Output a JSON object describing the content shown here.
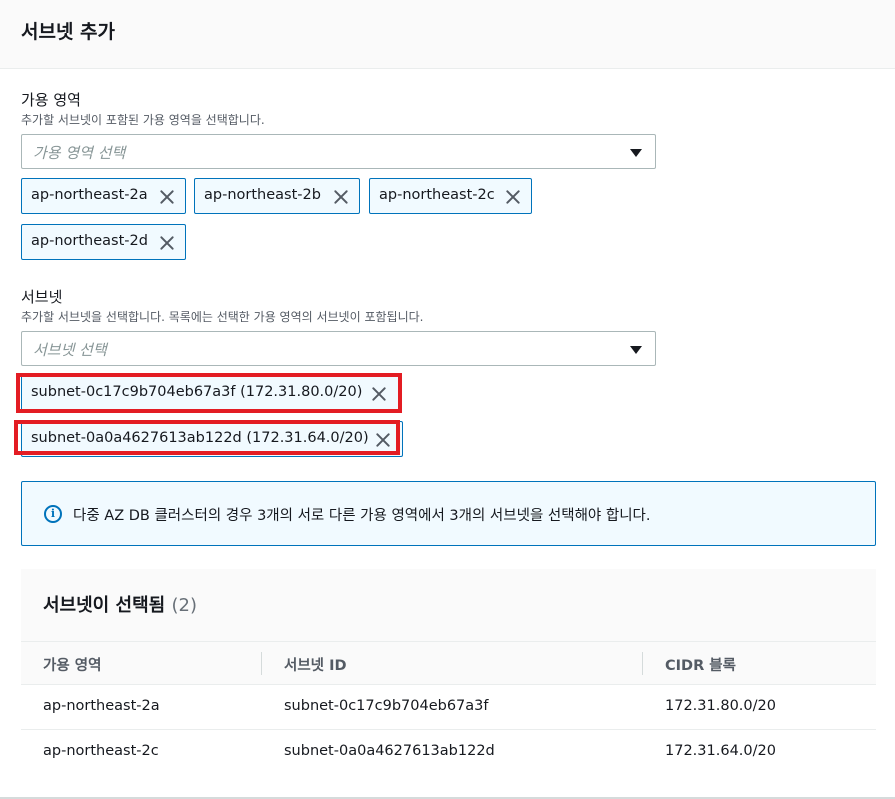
{
  "header": {
    "title": "서브넷 추가"
  },
  "az_field": {
    "label": "가용 영역",
    "description": "추가할 서브넷이 포함된 가용 영역을 선택합니다.",
    "placeholder": "가용 영역 선택",
    "tokens": [
      "ap-northeast-2a",
      "ap-northeast-2b",
      "ap-northeast-2c",
      "ap-northeast-2d"
    ]
  },
  "subnet_field": {
    "label": "서브넷",
    "description": "추가할 서브넷을 선택합니다. 목록에는 선택한 가용 영역의 서브넷이 포함됩니다.",
    "placeholder": "서브넷 선택",
    "tokens": [
      "subnet-0c17c9b704eb67a3f (172.31.80.0/20)",
      "subnet-0a0a4627613ab122d (172.31.64.0/20)"
    ]
  },
  "alert": {
    "icon": "info-icon",
    "text": "다중 AZ DB 클러스터의 경우 3개의 서로 다른 가용 영역에서 3개의 서브넷을 선택해야 합니다."
  },
  "selected_table": {
    "title": "서브넷이 선택됨",
    "count": "(2)",
    "columns": [
      "가용 영역",
      "서브넷 ID",
      "CIDR 블록"
    ],
    "rows": [
      [
        "ap-northeast-2a",
        "subnet-0c17c9b704eb67a3f",
        "172.31.80.0/20"
      ],
      [
        "ap-northeast-2c",
        "subnet-0a0a4627613ab122d",
        "172.31.64.0/20"
      ]
    ]
  },
  "colors": {
    "accent": "#0073bb",
    "token_background": "#f1faff",
    "highlight": "#e31c23"
  }
}
